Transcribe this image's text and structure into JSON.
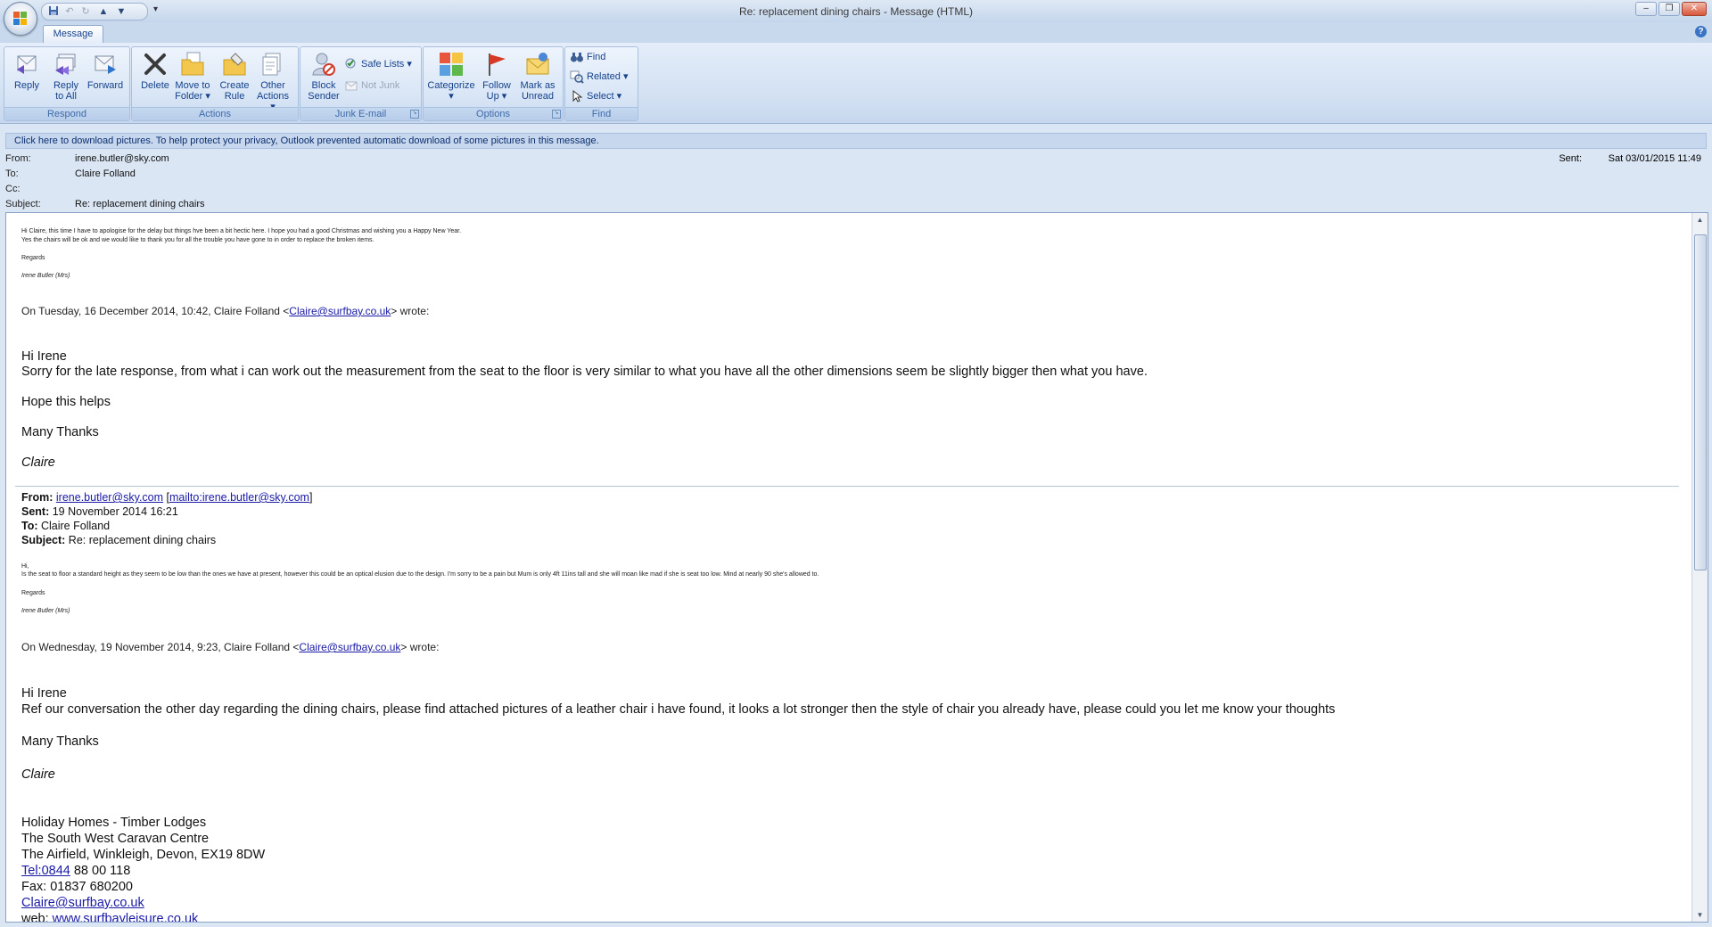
{
  "window": {
    "title": "Re: replacement dining chairs - Message (HTML)",
    "minimize": "–",
    "restore": "❐",
    "close": "✕",
    "qat_more": "▾"
  },
  "tabs": {
    "message": "Message",
    "help": "?"
  },
  "ribbon": {
    "respond": {
      "label": "Respond",
      "reply": "Reply",
      "reply_all_1": "Reply",
      "reply_all_2": "to All",
      "forward": "Forward"
    },
    "actions": {
      "label": "Actions",
      "delete": "Delete",
      "move_1": "Move to",
      "move_2": "Folder",
      "create_1": "Create",
      "create_2": "Rule",
      "other_1": "Other",
      "other_2": "Actions"
    },
    "junk": {
      "label": "Junk E-mail",
      "block_1": "Block",
      "block_2": "Sender",
      "safe_lists": "Safe Lists",
      "not_junk": "Not Junk"
    },
    "options": {
      "label": "Options",
      "categorize": "Categorize",
      "follow_1": "Follow",
      "follow_2": "Up",
      "mark_1": "Mark as",
      "mark_2": "Unread"
    },
    "find": {
      "label": "Find",
      "find": "Find",
      "related": "Related",
      "select": "Select"
    }
  },
  "infobar": "Click here to download pictures. To help protect your privacy, Outlook prevented automatic download of some pictures in this message.",
  "header": {
    "from_label": "From:",
    "from": "irene.butler@sky.com",
    "to_label": "To:",
    "to": "Claire Folland",
    "cc_label": "Cc:",
    "cc": "",
    "subject_label": "Subject:",
    "subject": "Re: replacement dining chairs",
    "sent_label": "Sent:",
    "sent": "Sat 03/01/2015 11:49"
  },
  "body": {
    "reply1_line1": "Hi Claire, this time I have to apologise for the delay but things hve been a bit hectic here. I hope you had a good Christmas and wishing you a Happy New Year.",
    "reply1_line2": " Yes the chairs will be ok and we would like to thank you for all the trouble you have gone to in order to replace the broken items.",
    "regards": "Regards",
    "sig_irene": "Irene Butler (Mrs)",
    "wrote1_pre": "On Tuesday, 16 December 2014, 10:42, Claire Folland <",
    "wrote1_email": "Claire@surfbay.co.uk",
    "wrote1_post": "> wrote:",
    "hi_irene": "Hi Irene",
    "claire1_line": "Sorry for the late response, from what i can work out the measurement from the seat to the floor is very similar to what you have all the other dimensions seem be slightly bigger then what you have.",
    "hope": "Hope this helps",
    "many_thanks": "Many Thanks",
    "claire_sig": "Claire",
    "q_from_label": "From:",
    "q_from_email": "irene.butler@sky.com",
    "q_from_mailto": "mailto:irene.butler@sky.com",
    "q_sent_label": "Sent:",
    "q_sent": " 19 November 2014 16:21",
    "q_to_label": "To:",
    "q_to": " Claire Folland",
    "q_subject_label": "Subject:",
    "q_subject": " Re: replacement dining chairs",
    "irene2_hi": "Hi,",
    "irene2_line": "Is the seat to floor a standard height as they seem to be low than the ones we have at present, however this could be an optical elusion due to the design. I'm sorry to be a pain but Mum is only 4ft 11ins tall and she will moan like mad if she is seat too low. Mind at nearly 90 she's allowed to.",
    "wrote2_pre": "On Wednesday, 19 November 2014, 9:23, Claire Folland <",
    "wrote2_email": "Claire@surfbay.co.uk",
    "wrote2_post": "> wrote:",
    "claire2_line": "Ref our conversation the other day regarding the dining chairs, please find attached pictures of a leather chair i have found, it looks a lot stronger then the style of chair you already have, please could you let me know your thoughts",
    "company": "Holiday Homes - Timber Lodges",
    "centre": "The South West Caravan Centre",
    "address": "The Airfield, Winkleigh, Devon, EX19 8DW",
    "tel_link": "Tel:0844",
    "tel_rest": " 88 00 118",
    "fax": "Fax: 01837 680200",
    "email_link": "Claire@surfbay.co.uk",
    "web_pre": "web: ",
    "web_link": "www.surfbayleisure.co.uk"
  }
}
